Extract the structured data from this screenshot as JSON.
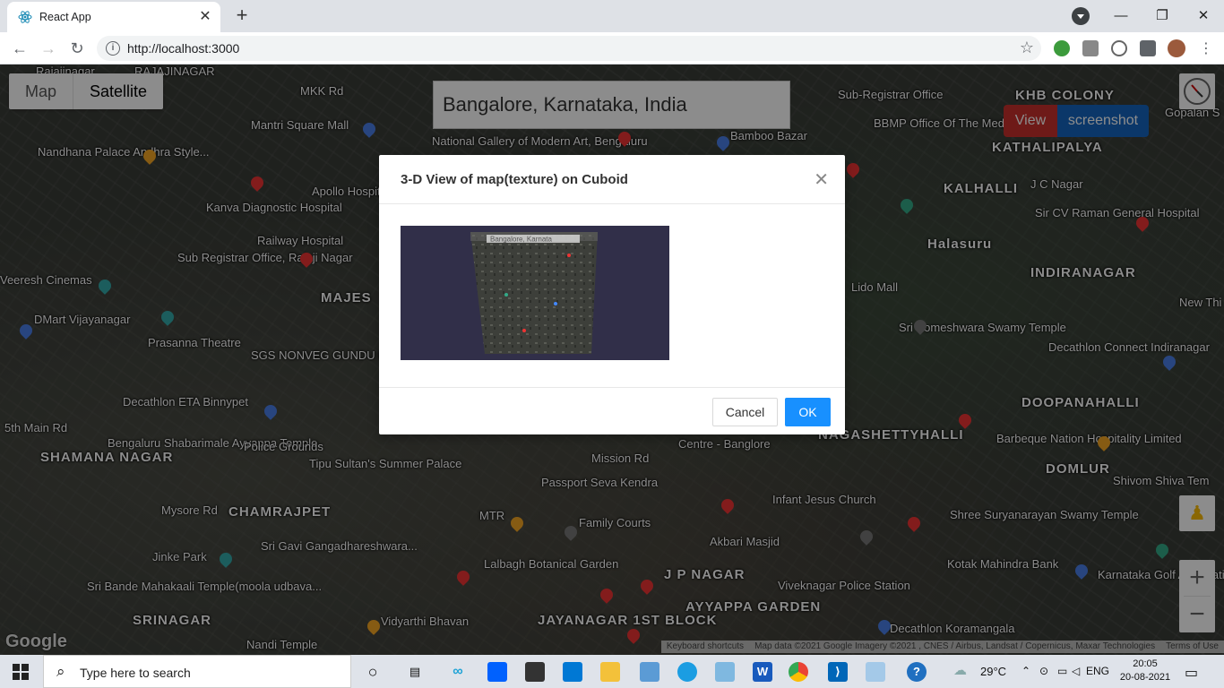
{
  "browser": {
    "tab_title": "React App",
    "tab_close": "✕",
    "new_tab": "+",
    "url": "http://localhost:3000",
    "controls": {
      "minimize": "—",
      "maximize": "❐",
      "close": "✕"
    }
  },
  "map": {
    "type_map": "Map",
    "type_satellite": "Satellite",
    "search_value": "Bangalore, Karnataka, India",
    "view_button": "View",
    "screenshot_button": "screenshot",
    "google_logo": "Google",
    "attribution": [
      "Keyboard shortcuts",
      "Map data ©2021 Google Imagery ©2021 , CNES / Airbus, Landsat / Copernicus, Maxar Technologies",
      "Terms of Use"
    ],
    "labels": [
      {
        "text": "Rajajinagar",
        "size": "s"
      },
      {
        "text": "RAJAJINAGAR",
        "size": "s"
      },
      {
        "text": "Nandhana Palace Andhra Style...",
        "size": "s"
      },
      {
        "text": "Mantri Square Mall",
        "size": "s"
      },
      {
        "text": "National Gallery of Modern Art, Bengaluru",
        "size": "s"
      },
      {
        "text": "Bamboo Bazar",
        "size": "s"
      },
      {
        "text": "Sub-Registrar Office",
        "size": "s"
      },
      {
        "text": "KHB COLONY",
        "size": "b"
      },
      {
        "text": "Gopalan S",
        "size": "s"
      },
      {
        "text": "BBMP Office Of The Medical Officer Of...",
        "size": "s"
      },
      {
        "text": "KATHALIPALYA",
        "size": "b"
      },
      {
        "text": "Apollo Hospital Sheshadripuram",
        "size": "s"
      },
      {
        "text": "Kanva Diagnostic Hospital",
        "size": "s"
      },
      {
        "text": "Railway Hospital",
        "size": "s"
      },
      {
        "text": "Sub Registrar Office, Rajaji Nagar",
        "size": "s"
      },
      {
        "text": "KALHALLI",
        "size": "b"
      },
      {
        "text": "J C Nagar",
        "size": "s"
      },
      {
        "text": "Sir CV Raman General Hospital",
        "size": "s"
      },
      {
        "text": "Halasuru",
        "size": "b"
      },
      {
        "text": "INDIRANAGAR",
        "size": "b"
      },
      {
        "text": "Lido Mall",
        "size": "s"
      },
      {
        "text": "New Thi",
        "size": "s"
      },
      {
        "text": "Sri Someshwara Swamy Temple",
        "size": "s"
      },
      {
        "text": "Decathlon Connect Indiranagar",
        "size": "s"
      },
      {
        "text": "DMart Vijayanagar",
        "size": "s"
      },
      {
        "text": "Prasanna Theatre",
        "size": "s"
      },
      {
        "text": "SGS NONVEG GUNDU PALAV(Balepet)",
        "size": "s"
      },
      {
        "text": "MAJES",
        "size": "b"
      },
      {
        "text": "Veeresh Cinemas",
        "size": "s"
      },
      {
        "text": "Decathlon ETA Binnypet",
        "size": "s"
      },
      {
        "text": "DOOPANAHALLI",
        "size": "b"
      },
      {
        "text": "Bengaluru Shabarimale Ayyappa Temple",
        "size": "s"
      },
      {
        "text": "Police Grounds",
        "size": "s"
      },
      {
        "text": "Centre - Banglore",
        "size": "s"
      },
      {
        "text": "NAGASHETTYHALLI",
        "size": "b"
      },
      {
        "text": "Barbeque Nation Hospitality Limited",
        "size": "s"
      },
      {
        "text": "SHAMANA NAGAR",
        "size": "b"
      },
      {
        "text": "Tipu Sultan's Summer Palace",
        "size": "s"
      },
      {
        "text": "Passport Seva Kendra",
        "size": "s"
      },
      {
        "text": "DOMLUR",
        "size": "b"
      },
      {
        "text": "Shivom Shiva Tem",
        "size": "s"
      },
      {
        "text": "Infant Jesus Church",
        "size": "s"
      },
      {
        "text": "CHAMRAJPET",
        "size": "b"
      },
      {
        "text": "MTR",
        "size": "s"
      },
      {
        "text": "Family Courts",
        "size": "s"
      },
      {
        "text": "Shree Suryanarayan Swamy Temple",
        "size": "s"
      },
      {
        "text": "Akbari Masjid",
        "size": "s"
      },
      {
        "text": "Sri Gavi Gangadhareshwara...",
        "size": "s"
      },
      {
        "text": "Jinke Park",
        "size": "s"
      },
      {
        "text": "Lalbagh Botanical Garden",
        "size": "s"
      },
      {
        "text": "J P NAGAR",
        "size": "b"
      },
      {
        "text": "Kotak Mahindra Bank",
        "size": "s"
      },
      {
        "text": "Karnataka Golf Association",
        "size": "s"
      },
      {
        "text": "Sri Bande Mahakaali Temple(moola udbava...",
        "size": "s"
      },
      {
        "text": "Viveknagar Police Station",
        "size": "s"
      },
      {
        "text": "AYYAPPA GARDEN",
        "size": "b"
      },
      {
        "text": "SRINAGAR",
        "size": "b"
      },
      {
        "text": "Vidyarthi Bhavan",
        "size": "s"
      },
      {
        "text": "JAYANAGAR 1ST BLOCK",
        "size": "b"
      },
      {
        "text": "Decathlon Koramangala",
        "size": "s"
      },
      {
        "text": "Nandi Temple",
        "size": "s"
      },
      {
        "text": "Mysore Rd",
        "size": "s"
      },
      {
        "text": "Mission Rd",
        "size": "s"
      },
      {
        "text": "5th Main Rd",
        "size": "s"
      },
      {
        "text": "MKK Rd",
        "size": "s"
      }
    ]
  },
  "modal": {
    "title": "3-D View of map(texture) on Cuboid",
    "close": "✕",
    "texture_caption": "Bangalore, Karnata",
    "cancel_label": "Cancel",
    "ok_label": "OK"
  },
  "taskbar": {
    "search_placeholder": "Type here to search",
    "weather": "29°C",
    "language": "ENG",
    "time": "20:05",
    "date": "20-08-2021"
  }
}
